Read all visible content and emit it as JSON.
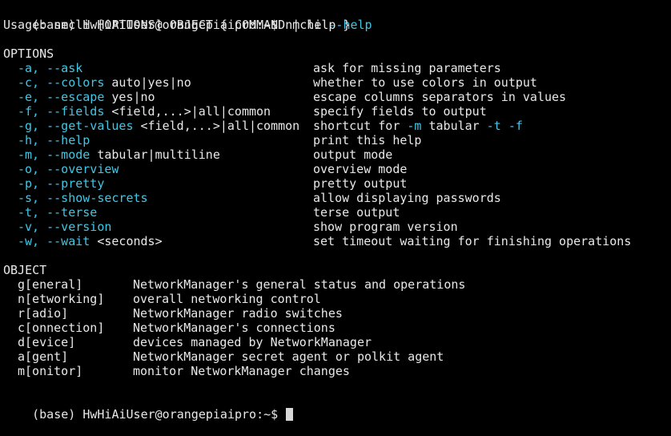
{
  "prompt": {
    "text": "(base) HwHiAiUser@orangepiaipro:~$ ",
    "command": "nmcli",
    "argument": "--help"
  },
  "usage": "Usage: nmcli [OPTIONS] OBJECT { COMMAND | help }",
  "options_heading": "OPTIONS",
  "options": [
    {
      "flags": "-a, --ask",
      "arg": "",
      "desc": "ask for missing parameters"
    },
    {
      "flags": "-c, --colors",
      "arg": " auto|yes|no",
      "desc": "whether to use colors in output"
    },
    {
      "flags": "-e, --escape",
      "arg": " yes|no",
      "desc": "escape columns separators in values"
    },
    {
      "flags": "-f, --fields",
      "arg": " <field,...>|all|common",
      "desc": "specify fields to output"
    },
    {
      "flags": "-g, --get-values",
      "arg": " <field,...>|all|common",
      "desc_parts": [
        "shortcut for ",
        "-m",
        " tabular ",
        "-t -f"
      ]
    },
    {
      "flags": "-h, --help",
      "arg": "",
      "desc": "print this help"
    },
    {
      "flags": "-m, --mode",
      "arg": " tabular|multiline",
      "desc": "output mode"
    },
    {
      "flags": "-o, --overview",
      "arg": "",
      "desc": "overview mode"
    },
    {
      "flags": "-p, --pretty",
      "arg": "",
      "desc": "pretty output"
    },
    {
      "flags": "-s, --show-secrets",
      "arg": "",
      "desc": "allow displaying passwords"
    },
    {
      "flags": "-t, --terse",
      "arg": "",
      "desc": "terse output"
    },
    {
      "flags": "-v, --version",
      "arg": "",
      "desc": "show program version"
    },
    {
      "flags": "-w, --wait",
      "arg": " <seconds>",
      "desc": "set timeout waiting for finishing operations"
    }
  ],
  "object_heading": "OBJECT",
  "objects": [
    {
      "name": "g[eneral]",
      "desc": "NetworkManager's general status and operations"
    },
    {
      "name": "n[etworking]",
      "desc": "overall networking control"
    },
    {
      "name": "r[adio]",
      "desc": "NetworkManager radio switches"
    },
    {
      "name": "c[onnection]",
      "desc": "NetworkManager's connections"
    },
    {
      "name": "d[evice]",
      "desc": "devices managed by NetworkManager"
    },
    {
      "name": "a[gent]",
      "desc": "NetworkManager secret agent or polkit agent"
    },
    {
      "name": "m[onitor]",
      "desc": "monitor NetworkManager changes"
    }
  ],
  "final_prompt": "(base) HwHiAiUser@orangepiaipro:~$ ",
  "colors": {
    "background": "#000000",
    "text": "#e8e8e8",
    "flag": "#3fc7e6"
  }
}
